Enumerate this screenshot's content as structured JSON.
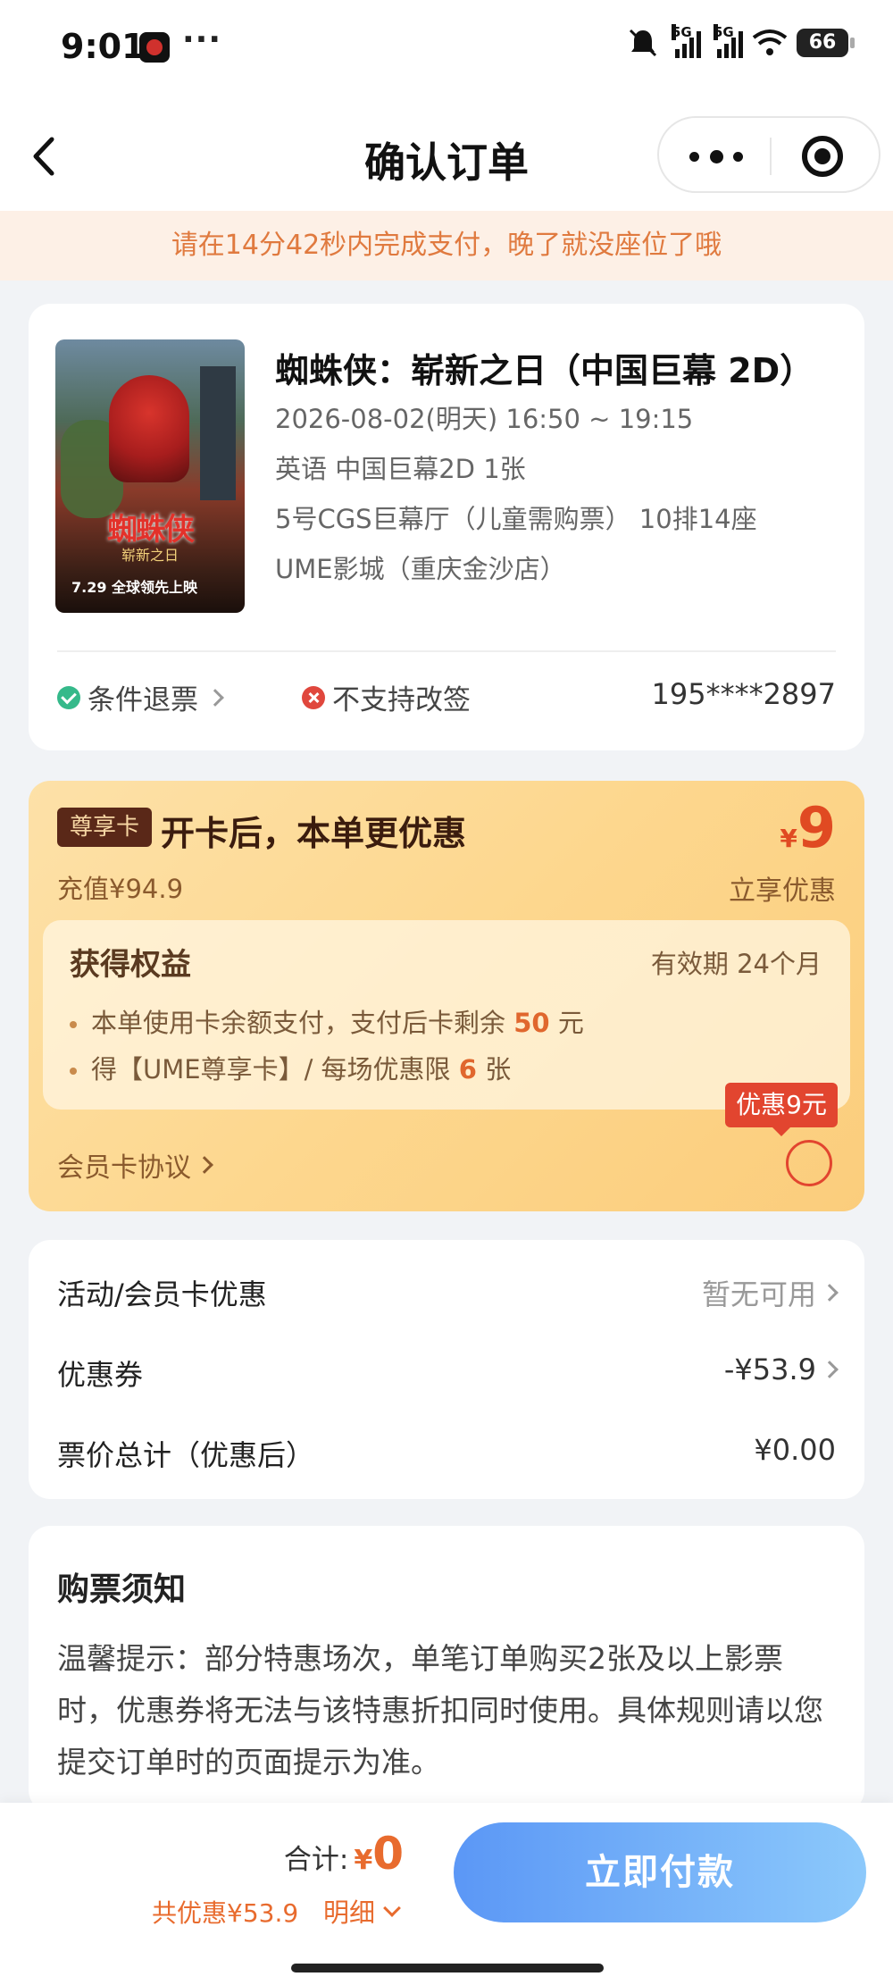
{
  "status_bar": {
    "time": "9:01",
    "dots": "···",
    "signal1": "5G",
    "signal2": "5G",
    "battery": "66"
  },
  "header": {
    "title": "确认订单"
  },
  "countdown": {
    "text": "请在14分42秒内完成支付，晚了就没座位了哦"
  },
  "movie": {
    "poster_title": "蜘蛛侠",
    "poster_subtitle": "崭新之日",
    "poster_date": "7.29 全球领先上映",
    "title": "蜘蛛侠：崭新之日（中国巨幕 2D）",
    "showtime": "2026-08-02(明天) 16:50 ~ 19:15",
    "language_format": "英语 中国巨幕2D 1张",
    "hall_seat": "5号CGS巨幕厅（儿童需购票） 10排14座",
    "cinema": "UME影城（重庆金沙店）",
    "refund_policy": "条件退票",
    "change_policy": "不支持改签",
    "phone": "195****2897"
  },
  "member": {
    "badge": "尊享卡",
    "title": "开卡后，本单更优惠",
    "recharge": "充值¥94.9",
    "save_currency": "¥",
    "save_amount": "9",
    "save_label": "立享优惠",
    "benefit_title": "获得权益",
    "validity": "有效期 24个月",
    "benefit_line1_pre": "本单使用卡余额支付，支付后卡剩余",
    "benefit_line1_value": "50",
    "benefit_line1_post": "元",
    "benefit_line2_pre": "得【UME尊享卡】/ 每场优惠限",
    "benefit_line2_value": "6",
    "benefit_line2_post": "张",
    "agreement": "会员卡协议",
    "discount_tag": "优惠9元",
    "selected": false
  },
  "price": {
    "activity_label": "活动/会员卡优惠",
    "activity_value": "暂无可用",
    "coupon_label": "优惠券",
    "coupon_value": "-¥53.9",
    "total_label": "票价总计（优惠后）",
    "total_value": "¥0.00"
  },
  "notice": {
    "title": "购票须知",
    "text": "温馨提示：部分特惠场次，单笔订单购买2张及以上影票时，优惠券将无法与该特惠折扣同时使用。具体规则请以您提交订单时的页面提示为准。"
  },
  "bottom": {
    "total_label": "合计:",
    "currency": "¥",
    "total_amount": "0",
    "saved": "共优惠¥53.9",
    "detail": "明细",
    "pay_button": "立即付款"
  },
  "colors": {
    "accent_orange": "#e86b2e",
    "discount_red": "#e2452f",
    "pay_blue": "#5b97f6",
    "success_green": "#35b98a",
    "error_red": "#e0473d"
  }
}
